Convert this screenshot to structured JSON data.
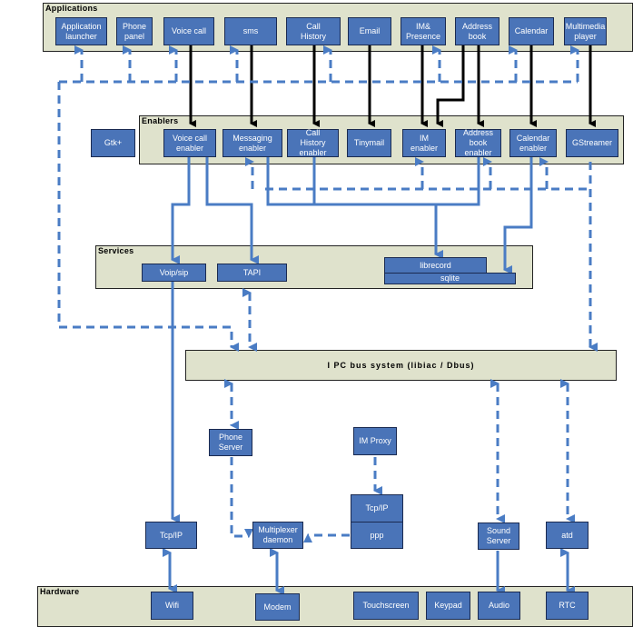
{
  "applications": {
    "title": "Applications",
    "items": [
      "Application\nlauncher",
      "Phone\npanel",
      "Voice call",
      "sms",
      "Call\nHistory",
      "Email",
      "IM&\nPresence",
      "Address\nbook",
      "Calendar",
      "Multimedia\nplayer"
    ]
  },
  "enablers": {
    "title": "Enablers",
    "gtk": "Gtk+",
    "items": [
      "Voice call\nenabler",
      "Messaging\nenabler",
      "Call\nHistory\nenabler",
      "Tinymail",
      "IM\nenabler",
      "Address\nbook\nenabler",
      "Calendar\nenabler",
      "GStreamer"
    ]
  },
  "services": {
    "title": "Services",
    "items": [
      "Voip/sip",
      "TAPI",
      "librecord",
      "sqlite"
    ]
  },
  "ipc": {
    "label": "I PC bus system (libiac /  Dbus)"
  },
  "middle": {
    "phone_server": "Phone\nServer",
    "im_proxy": "IM Proxy",
    "tcpip_ppp": "Tcp/IP",
    "ppp": "ppp",
    "tcpip": "Tcp/IP",
    "multiplexer": "Multiplexer\ndaemon",
    "sound_server": "Sound\nServer",
    "atd": "atd"
  },
  "hardware": {
    "title": "Hardware",
    "items": [
      "Wifi",
      "Modem",
      "Touchscreen",
      "Keypad",
      "Audio",
      "RTC"
    ]
  },
  "colors": {
    "panel": "#dfe2cc",
    "box": "#4a74b8",
    "arrow_blue": "#4a7cc4",
    "arrow_black": "#000000"
  }
}
